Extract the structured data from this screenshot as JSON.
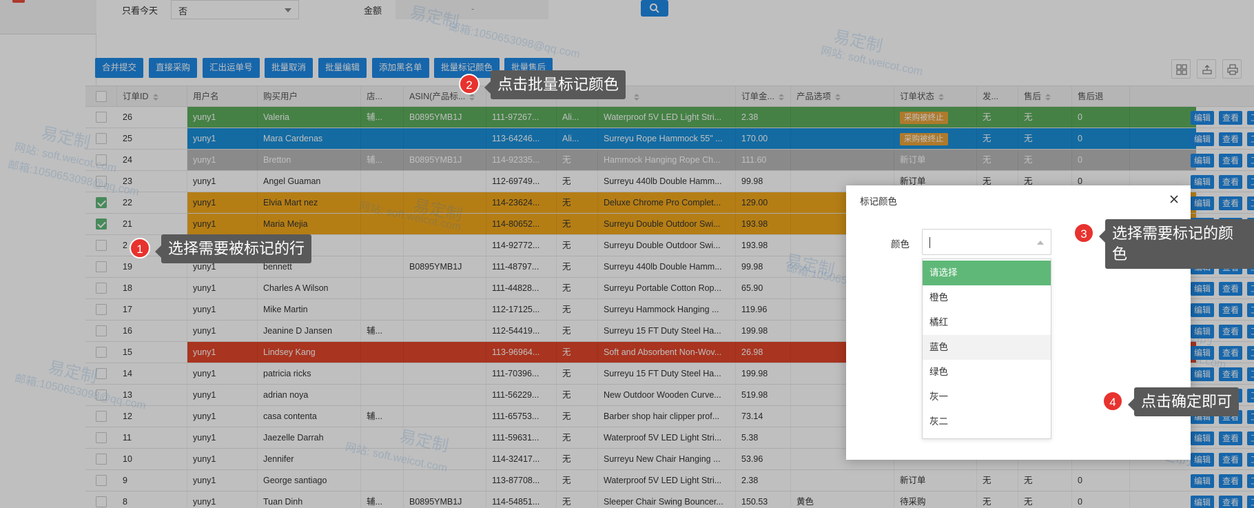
{
  "filters": {
    "only_today_label": "只看今天",
    "only_today_value": "否",
    "amount_label": "金额",
    "amount_separator": "-"
  },
  "toolbar": {
    "buttons": [
      "合并提交",
      "直接采购",
      "汇出运单号",
      "批量取消",
      "批量编辑",
      "添加黑名单",
      "批量标记颜色",
      "批量售后"
    ]
  },
  "table": {
    "headers": [
      "订单ID",
      "用户名",
      "购买用户",
      "店...",
      "ASIN(产品标...",
      "",
      "",
      "",
      "订单金...",
      "产品选项",
      "订单状态",
      "发...",
      "售后",
      "售后退"
    ],
    "rows": [
      {
        "id": "26",
        "user": "yuny1",
        "buyer": "Valeria",
        "shop": "辅...",
        "asin": "B0895YMB1J",
        "order": "111-97267...",
        "ch": "Ali...",
        "product": "Waterproof 5V LED Light Stri...",
        "amount": "2.38",
        "option": "",
        "status": "采购被终止",
        "ship": "无",
        "after": "无",
        "refund": "0",
        "color": "#5cac5c",
        "checked": false
      },
      {
        "id": "25",
        "user": "yuny1",
        "buyer": "Mara Cardenas",
        "shop": "",
        "asin": "",
        "order": "113-64246...",
        "ch": "Ali...",
        "product": "Surreyu Rope Hammock 55\" ...",
        "amount": "170.00",
        "option": "",
        "status": "采购被终止",
        "ship": "无",
        "after": "无",
        "refund": "0",
        "color": "#1a8fd9",
        "checked": false
      },
      {
        "id": "24",
        "user": "yuny1",
        "buyer": "Bretton",
        "shop": "辅...",
        "asin": "B0895YMB1J",
        "order": "114-92335...",
        "ch": "无",
        "product": "Hammock Hanging Rope Ch...",
        "amount": "111.60",
        "option": "",
        "status": "新订单",
        "ship": "无",
        "after": "无",
        "refund": "0",
        "color": "#b8b8b8",
        "checked": false
      },
      {
        "id": "23",
        "user": "yuny1",
        "buyer": "Angel Guaman",
        "shop": "",
        "asin": "",
        "order": "112-69749...",
        "ch": "无",
        "product": "Surreyu 440lb Double Hamm...",
        "amount": "99.98",
        "option": "",
        "status": "新订单",
        "ship": "无",
        "after": "无",
        "refund": "0",
        "color": "",
        "checked": false
      },
      {
        "id": "22",
        "user": "yuny1",
        "buyer": "Elvia Mart nez",
        "shop": "",
        "asin": "",
        "order": "114-23624...",
        "ch": "无",
        "product": "Deluxe Chrome Pro Complet...",
        "amount": "129.00",
        "option": "",
        "status": "",
        "ship": "",
        "after": "",
        "refund": "",
        "color": "#f2a81d",
        "checked": true
      },
      {
        "id": "21",
        "user": "yuny1",
        "buyer": "Maria Mejia",
        "shop": "",
        "asin": "",
        "order": "114-80652...",
        "ch": "无",
        "product": "Surreyu Double Outdoor Swi...",
        "amount": "193.98",
        "option": "",
        "status": "",
        "ship": "",
        "after": "",
        "refund": "",
        "color": "#f2a81d",
        "checked": true
      },
      {
        "id": "2",
        "user": "",
        "buyer": "",
        "shop": "",
        "asin": "",
        "order": "114-92772...",
        "ch": "无",
        "product": "Surreyu Double Outdoor Swi...",
        "amount": "193.98",
        "option": "",
        "status": "",
        "ship": "",
        "after": "",
        "refund": "",
        "color": "",
        "checked": false
      },
      {
        "id": "19",
        "user": "yuny1",
        "buyer": "bennett",
        "shop": "",
        "asin": "B0895YMB1J",
        "order": "111-48797...",
        "ch": "无",
        "product": "Surreyu 440lb Double Hamm...",
        "amount": "99.98",
        "option": "",
        "status": "",
        "ship": "",
        "after": "",
        "refund": "",
        "color": "",
        "checked": false
      },
      {
        "id": "18",
        "user": "yuny1",
        "buyer": "Charles A Wilson",
        "shop": "",
        "asin": "",
        "order": "111-44828...",
        "ch": "无",
        "product": "Surreyu Portable Cotton Rop...",
        "amount": "65.90",
        "option": "",
        "status": "",
        "ship": "",
        "after": "",
        "refund": "",
        "color": "",
        "checked": false
      },
      {
        "id": "17",
        "user": "yuny1",
        "buyer": "Mike Martin",
        "shop": "",
        "asin": "",
        "order": "112-17125...",
        "ch": "无",
        "product": "Surreyu Hammock Hanging ...",
        "amount": "119.96",
        "option": "",
        "status": "",
        "ship": "",
        "after": "",
        "refund": "",
        "color": "",
        "checked": false
      },
      {
        "id": "16",
        "user": "yuny1",
        "buyer": "Jeanine D Jansen",
        "shop": "辅...",
        "asin": "",
        "order": "112-54419...",
        "ch": "无",
        "product": "Surreyu 15 FT Duty Steel Ha...",
        "amount": "199.98",
        "option": "",
        "status": "",
        "ship": "",
        "after": "",
        "refund": "",
        "color": "",
        "checked": false
      },
      {
        "id": "15",
        "user": "yuny1",
        "buyer": "Lindsey Kang",
        "shop": "",
        "asin": "",
        "order": "113-96964...",
        "ch": "无",
        "product": "Soft and Absorbent Non-Wov...",
        "amount": "26.98",
        "option": "",
        "status": "",
        "ship": "",
        "after": "",
        "refund": "",
        "color": "#e2462a",
        "checked": false
      },
      {
        "id": "14",
        "user": "yuny1",
        "buyer": "patricia ricks",
        "shop": "",
        "asin": "",
        "order": "111-70396...",
        "ch": "无",
        "product": "Surreyu 15 FT Duty Steel Ha...",
        "amount": "199.98",
        "option": "",
        "status": "",
        "ship": "",
        "after": "",
        "refund": "",
        "color": "",
        "checked": false
      },
      {
        "id": "13",
        "user": "yuny1",
        "buyer": "adrian noya",
        "shop": "",
        "asin": "",
        "order": "111-56229...",
        "ch": "无",
        "product": "New Outdoor Wooden Curve...",
        "amount": "519.98",
        "option": "",
        "status": "",
        "ship": "",
        "after": "",
        "refund": "",
        "color": "",
        "checked": false
      },
      {
        "id": "12",
        "user": "yuny1",
        "buyer": "casa contenta",
        "shop": "辅...",
        "asin": "",
        "order": "111-65753...",
        "ch": "无",
        "product": "Barber shop hair clipper prof...",
        "amount": "73.14",
        "option": "",
        "status": "",
        "ship": "",
        "after": "",
        "refund": "",
        "color": "",
        "checked": false
      },
      {
        "id": "11",
        "user": "yuny1",
        "buyer": "Jaezelle Darrah",
        "shop": "",
        "asin": "",
        "order": "111-59631...",
        "ch": "无",
        "product": "Waterproof 5V LED Light Stri...",
        "amount": "5.38",
        "option": "",
        "status": "",
        "ship": "",
        "after": "",
        "refund": "",
        "color": "",
        "checked": false
      },
      {
        "id": "10",
        "user": "yuny1",
        "buyer": "Jennifer",
        "shop": "",
        "asin": "",
        "order": "114-32417...",
        "ch": "无",
        "product": "Surreyu New Chair Hanging ...",
        "amount": "53.96",
        "option": "",
        "status": "",
        "ship": "",
        "after": "",
        "refund": "",
        "color": "",
        "checked": false
      },
      {
        "id": "9",
        "user": "yuny1",
        "buyer": "George santiago",
        "shop": "",
        "asin": "",
        "order": "113-87708...",
        "ch": "无",
        "product": "Waterproof 5V LED Light Stri...",
        "amount": "2.38",
        "option": "",
        "status": "新订单",
        "ship": "无",
        "after": "无",
        "refund": "0",
        "color": "",
        "checked": false
      },
      {
        "id": "8",
        "user": "yuny1",
        "buyer": "Tuan Dinh",
        "shop": "辅...",
        "asin": "B0895YMB1J",
        "order": "114-54851...",
        "ch": "无",
        "product": "Sleeper Chair Swing Bouncer...",
        "amount": "150.53",
        "option": "黄色",
        "status": "待采购",
        "ship": "无",
        "after": "无",
        "refund": "0",
        "color": "",
        "checked": false
      }
    ],
    "actions": [
      "编辑",
      "查看",
      "工单"
    ]
  },
  "modal": {
    "title": "标记颜色",
    "field_label": "颜色",
    "options": [
      "请选择",
      "橙色",
      "橘红",
      "蓝色",
      "绿色",
      "灰一",
      "灰二"
    ]
  },
  "callouts": {
    "c1_num": "1",
    "c1_text": "选择需要被标记的行",
    "c2_num": "2",
    "c2_text": "点击批量标记颜色",
    "c3_num": "3",
    "c3_text": "选择需要标记的颜色",
    "c4_num": "4",
    "c4_text": "点击确定即可"
  },
  "watermark": {
    "brand": "易定制",
    "site": "网站: soft.weicot.com",
    "mail": "邮箱:1050653098@qq.com"
  }
}
